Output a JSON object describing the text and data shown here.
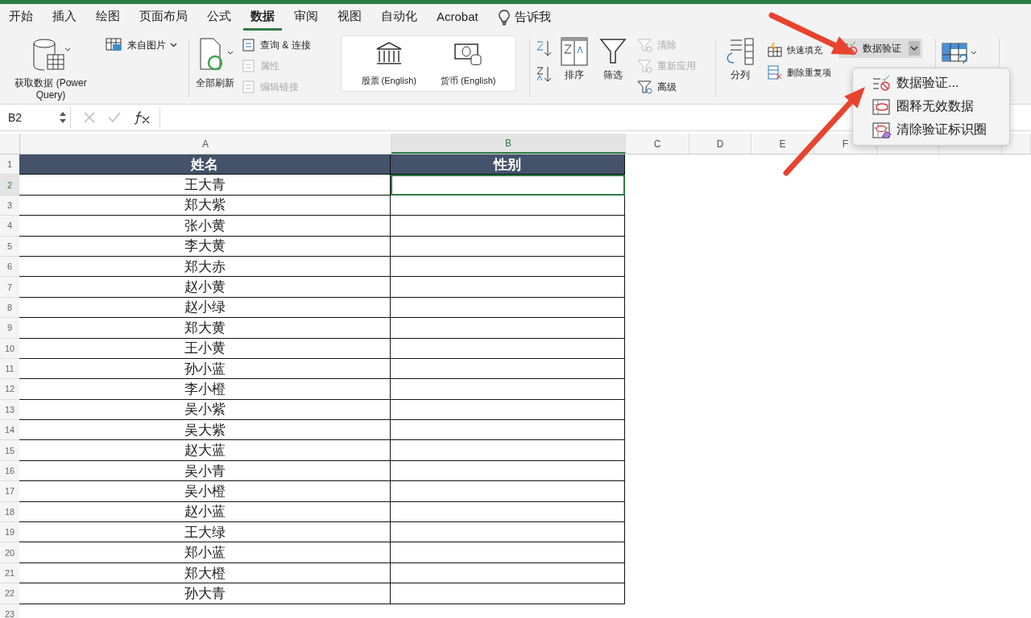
{
  "tabs": [
    {
      "label": "开始",
      "selected": false
    },
    {
      "label": "插入",
      "selected": false
    },
    {
      "label": "绘图",
      "selected": false
    },
    {
      "label": "页面布局",
      "selected": false
    },
    {
      "label": "公式",
      "selected": false
    },
    {
      "label": "数据",
      "selected": true
    },
    {
      "label": "审阅",
      "selected": false
    },
    {
      "label": "视图",
      "selected": false
    },
    {
      "label": "自动化",
      "selected": false
    },
    {
      "label": "Acrobat",
      "selected": false
    }
  ],
  "tell_me": "告诉我",
  "ribbon": {
    "get_data": {
      "label": "获取数据 (Power Query)",
      "from_picture": "来自图片"
    },
    "refresh_all": "全部刷新",
    "query_items": [
      {
        "label": "查询 & 连接",
        "disabled": false
      },
      {
        "label": "属性",
        "disabled": true
      },
      {
        "label": "编辑链接",
        "disabled": true
      }
    ],
    "data_types": [
      {
        "kind": "bank",
        "label": "股票 (English)"
      },
      {
        "kind": "money",
        "label": "货币 (English)"
      }
    ],
    "sort": "排序",
    "filter": "筛选",
    "filter_items": [
      {
        "label": "清除",
        "disabled": true
      },
      {
        "label": "重新应用",
        "disabled": true
      },
      {
        "label": "高级",
        "disabled": false
      }
    ],
    "text_to_columns": "分列",
    "flash_fill": "快速填充",
    "remove_duplicates": "删除重复项",
    "data_validation": {
      "label": "数据验证",
      "expanded": true
    }
  },
  "validation_menu": [
    {
      "kind": "validate",
      "label": "数据验证..."
    },
    {
      "kind": "circle",
      "label": "圈释无效数据"
    },
    {
      "kind": "clear",
      "label": "清除验证标识圈"
    }
  ],
  "formula_bar": {
    "name_box": "B2"
  },
  "sheet": {
    "columns": [
      {
        "label": "A",
        "selected": false
      },
      {
        "label": "B",
        "selected": true
      },
      {
        "label": "C",
        "selected": false
      },
      {
        "label": "D",
        "selected": false
      },
      {
        "label": "E",
        "selected": false
      },
      {
        "label": "F",
        "selected": false
      }
    ],
    "header_row_number": "1",
    "header": [
      "姓名",
      "性别"
    ],
    "rows": [
      {
        "number": "2",
        "name": "王大青",
        "selected": true
      },
      {
        "number": "3",
        "name": "郑大紫",
        "selected": false
      },
      {
        "number": "4",
        "name": "张小黄",
        "selected": false
      },
      {
        "number": "5",
        "name": "李大黄",
        "selected": false
      },
      {
        "number": "6",
        "name": "郑大赤",
        "selected": false
      },
      {
        "number": "7",
        "name": "赵小黄",
        "selected": false
      },
      {
        "number": "8",
        "name": "赵小绿",
        "selected": false
      },
      {
        "number": "9",
        "name": "郑大黄",
        "selected": false
      },
      {
        "number": "10",
        "name": "王小黄",
        "selected": false
      },
      {
        "number": "11",
        "name": "孙小蓝",
        "selected": false
      },
      {
        "number": "12",
        "name": "李小橙",
        "selected": false
      },
      {
        "number": "13",
        "name": "吴小紫",
        "selected": false
      },
      {
        "number": "14",
        "name": "吴大紫",
        "selected": false
      },
      {
        "number": "15",
        "name": "赵大蓝",
        "selected": false
      },
      {
        "number": "16",
        "name": "吴小青",
        "selected": false
      },
      {
        "number": "17",
        "name": "吴小橙",
        "selected": false
      },
      {
        "number": "18",
        "name": "赵小蓝",
        "selected": false
      },
      {
        "number": "19",
        "name": "王大绿",
        "selected": false
      },
      {
        "number": "20",
        "name": "郑小蓝",
        "selected": false
      },
      {
        "number": "21",
        "name": "郑大橙",
        "selected": false
      },
      {
        "number": "22",
        "name": "孙大青",
        "selected": false
      }
    ],
    "empty_rows": [
      "23"
    ]
  }
}
